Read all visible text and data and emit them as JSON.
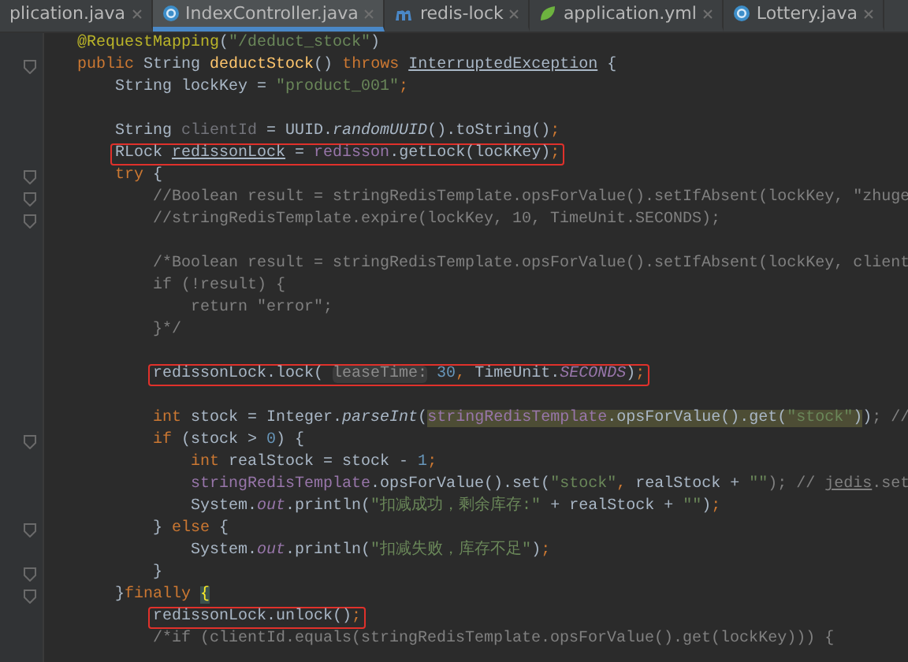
{
  "tabs": [
    {
      "label": "plication.java",
      "kind": "partial",
      "selected": false
    },
    {
      "label": "IndexController.java",
      "kind": "java",
      "selected": true
    },
    {
      "label": "redis-lock",
      "kind": "module",
      "selected": false
    },
    {
      "label": "application.yml",
      "kind": "config",
      "selected": false
    },
    {
      "label": "Lottery.java",
      "kind": "java",
      "selected": false
    }
  ],
  "lines": [
    {
      "kind": "code",
      "fold": false,
      "boxed": false,
      "tokens": [
        {
          "text": "@RequestMapping",
          "kind": "annotation"
        },
        {
          "text": "(",
          "kind": "plain"
        },
        {
          "text": "\"/deduct_stock\"",
          "kind": "string"
        },
        {
          "text": ")",
          "kind": "plain"
        }
      ]
    },
    {
      "kind": "code",
      "fold": true,
      "boxed": false,
      "tokens": [
        {
          "text": "public ",
          "kind": "keyword"
        },
        {
          "text": "String ",
          "kind": "plain"
        },
        {
          "text": "deductStock",
          "kind": "method"
        },
        {
          "text": "() ",
          "kind": "plain"
        },
        {
          "text": "throws ",
          "kind": "keyword"
        },
        {
          "text": "InterruptedException",
          "kind": "underline"
        },
        {
          "text": " {",
          "kind": "plain"
        }
      ],
      "children": [
        {
          "kind": "code",
          "fold": false,
          "boxed": false,
          "tokens": [
            {
              "text": "String lockKey = ",
              "kind": "plain"
            },
            {
              "text": "\"product_001\"",
              "kind": "string"
            },
            {
              "text": ";",
              "kind": "keyword"
            }
          ]
        },
        {
          "kind": "blank"
        },
        {
          "kind": "code",
          "fold": false,
          "boxed": false,
          "tokens": [
            {
              "text": "String ",
              "kind": "plain"
            },
            {
              "text": "clientId",
              "kind": "unused"
            },
            {
              "text": " = UUID.",
              "kind": "plain"
            },
            {
              "text": "randomUUID",
              "kind": "italic"
            },
            {
              "text": "().toString()",
              "kind": "plain"
            },
            {
              "text": ";",
              "kind": "keyword"
            }
          ]
        },
        {
          "kind": "code",
          "fold": false,
          "boxed": true,
          "tokens": [
            {
              "text": "RLock ",
              "kind": "plain"
            },
            {
              "text": "redissonLock",
              "kind": "underline"
            },
            {
              "text": " = ",
              "kind": "plain"
            },
            {
              "text": "redisson",
              "kind": "field"
            },
            {
              "text": ".getLock(lockKey)",
              "kind": "plain"
            },
            {
              "text": ";",
              "kind": "keyword"
            }
          ]
        },
        {
          "kind": "code",
          "fold": true,
          "boxed": false,
          "tokens": [
            {
              "text": "try ",
              "kind": "keyword"
            },
            {
              "text": "{",
              "kind": "plain"
            }
          ],
          "children": [
            {
              "kind": "code",
              "fold": true,
              "boxed": false,
              "tokens": [
                {
                  "text": "//Boolean result = stringRedisTemplate.opsForValue().setIfAbsent(lockKey, \"zhuge",
                  "kind": "comment"
                }
              ]
            },
            {
              "kind": "code",
              "fold": true,
              "boxed": false,
              "tokens": [
                {
                  "text": "//stringRedisTemplate.expire(lockKey, 10, TimeUnit.SECONDS);",
                  "kind": "comment"
                }
              ]
            },
            {
              "kind": "blank"
            },
            {
              "kind": "code",
              "fold": false,
              "boxed": false,
              "tokens": [
                {
                  "text": "/*Boolean result = stringRedisTemplate.opsForValue().setIfAbsent(lockKey, client",
                  "kind": "comment"
                }
              ]
            },
            {
              "kind": "code",
              "fold": false,
              "boxed": false,
              "tokens": [
                {
                  "text": "if (!result) {",
                  "kind": "comment"
                }
              ],
              "children": [
                {
                  "kind": "code",
                  "fold": false,
                  "boxed": false,
                  "tokens": [
                    {
                      "text": "return \"error\";",
                      "kind": "comment"
                    }
                  ]
                }
              ]
            },
            {
              "kind": "code",
              "fold": false,
              "boxed": false,
              "tokens": [
                {
                  "text": "}*/",
                  "kind": "comment"
                }
              ]
            },
            {
              "kind": "blank"
            },
            {
              "kind": "code",
              "fold": false,
              "boxed": true,
              "tokens": [
                {
                  "text": "redissonLock.lock( ",
                  "kind": "plain"
                },
                {
                  "text": "leaseTime:",
                  "kind": "hint"
                },
                {
                  "text": " 30",
                  "kind": "number"
                },
                {
                  "text": ", ",
                  "kind": "keyword"
                },
                {
                  "text": "TimeUnit.",
                  "kind": "plain"
                },
                {
                  "text": "SECONDS",
                  "kind": "static"
                },
                {
                  "text": ")",
                  "kind": "plain"
                },
                {
                  "text": ";",
                  "kind": "keyword"
                }
              ]
            },
            {
              "kind": "blank"
            },
            {
              "kind": "code",
              "fold": false,
              "boxed": false,
              "tokens": [
                {
                  "text": "int ",
                  "kind": "keyword"
                },
                {
                  "text": "stock = Integer.",
                  "kind": "plain"
                },
                {
                  "text": "parseInt",
                  "kind": "italic"
                },
                {
                  "text": "(",
                  "kind": "plain"
                },
                {
                  "text": "stringRedisTemplate",
                  "kind": "field-match"
                },
                {
                  "text": ".opsForValue().get(",
                  "kind": "plain-match"
                },
                {
                  "text": "\"stock\"",
                  "kind": "string-match"
                },
                {
                  "text": ")",
                  "kind": "plain-match"
                },
                {
                  "text": ")",
                  "kind": "plain"
                },
                {
                  "text": "; //",
                  "kind": "comment"
                }
              ]
            },
            {
              "kind": "code",
              "fold": true,
              "boxed": false,
              "tokens": [
                {
                  "text": "if ",
                  "kind": "keyword"
                },
                {
                  "text": "(stock > ",
                  "kind": "plain"
                },
                {
                  "text": "0",
                  "kind": "number"
                },
                {
                  "text": ") {",
                  "kind": "plain"
                }
              ],
              "children": [
                {
                  "kind": "code",
                  "fold": false,
                  "boxed": false,
                  "tokens": [
                    {
                      "text": "int ",
                      "kind": "keyword"
                    },
                    {
                      "text": "realStock = stock - ",
                      "kind": "plain"
                    },
                    {
                      "text": "1",
                      "kind": "number"
                    },
                    {
                      "text": ";",
                      "kind": "keyword"
                    }
                  ]
                },
                {
                  "kind": "code",
                  "fold": false,
                  "boxed": false,
                  "tokens": [
                    {
                      "text": "stringRedisTemplate",
                      "kind": "field"
                    },
                    {
                      "text": ".opsForValue().set(",
                      "kind": "plain"
                    },
                    {
                      "text": "\"stock\"",
                      "kind": "string"
                    },
                    {
                      "text": ", ",
                      "kind": "keyword"
                    },
                    {
                      "text": "realStock + ",
                      "kind": "plain"
                    },
                    {
                      "text": "\"\"",
                      "kind": "string"
                    },
                    {
                      "text": "); // ",
                      "kind": "comment"
                    },
                    {
                      "text": "jedis",
                      "kind": "comment-underline"
                    },
                    {
                      "text": ".set",
                      "kind": "comment"
                    }
                  ]
                },
                {
                  "kind": "code",
                  "fold": false,
                  "boxed": false,
                  "tokens": [
                    {
                      "text": "System.",
                      "kind": "plain"
                    },
                    {
                      "text": "out",
                      "kind": "static"
                    },
                    {
                      "text": ".println(",
                      "kind": "plain"
                    },
                    {
                      "text": "\"扣减成功，剩余库存:\"",
                      "kind": "string"
                    },
                    {
                      "text": " + realStock + ",
                      "kind": "plain"
                    },
                    {
                      "text": "\"\"",
                      "kind": "string"
                    },
                    {
                      "text": ")",
                      "kind": "plain"
                    },
                    {
                      "text": ";",
                      "kind": "keyword"
                    }
                  ]
                }
              ]
            },
            {
              "kind": "code",
              "fold": true,
              "boxed": false,
              "tokens": [
                {
                  "text": "} ",
                  "kind": "plain"
                },
                {
                  "text": "else ",
                  "kind": "keyword"
                },
                {
                  "text": "{",
                  "kind": "plain"
                }
              ],
              "children": [
                {
                  "kind": "code",
                  "fold": false,
                  "boxed": false,
                  "tokens": [
                    {
                      "text": "System.",
                      "kind": "plain"
                    },
                    {
                      "text": "out",
                      "kind": "static"
                    },
                    {
                      "text": ".println(",
                      "kind": "plain"
                    },
                    {
                      "text": "\"扣减失败，库存不足\"",
                      "kind": "string"
                    },
                    {
                      "text": ")",
                      "kind": "plain"
                    },
                    {
                      "text": ";",
                      "kind": "keyword"
                    }
                  ]
                }
              ]
            },
            {
              "kind": "code",
              "fold": true,
              "boxed": false,
              "tokens": [
                {
                  "text": "}",
                  "kind": "plain"
                }
              ]
            }
          ]
        },
        {
          "kind": "code",
          "fold": true,
          "boxed": false,
          "tokens": [
            {
              "text": "}",
              "kind": "plain"
            },
            {
              "text": "finally ",
              "kind": "keyword"
            },
            {
              "text": "{",
              "kind": "brace-match"
            }
          ],
          "children": [
            {
              "kind": "code",
              "fold": false,
              "boxed": true,
              "tokens": [
                {
                  "text": "redissonLock.unlock()",
                  "kind": "plain"
                },
                {
                  "text": ";",
                  "kind": "keyword"
                }
              ]
            },
            {
              "kind": "code",
              "fold": false,
              "boxed": false,
              "tokens": [
                {
                  "text": "/*if (clientId.equals(stringRedisTemplate.opsForValue().get(lockKey))) {",
                  "kind": "comment"
                }
              ]
            }
          ]
        }
      ]
    }
  ]
}
